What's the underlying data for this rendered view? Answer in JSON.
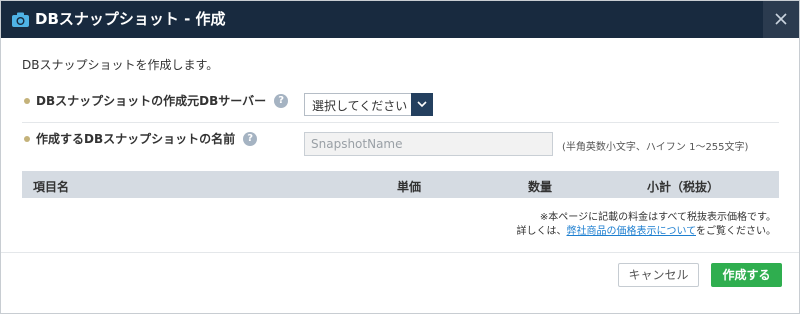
{
  "dialog": {
    "title": "DBスナップショット - 作成",
    "title_icon": "camera-icon",
    "close_icon": "close-icon",
    "intro": "DBスナップショットを作成します。"
  },
  "form": {
    "source_server": {
      "label": "DBスナップショットの作成元DBサーバー",
      "help": "?",
      "selected": "選択してください"
    },
    "snapshot_name": {
      "label": "作成するDBスナップショットの名前",
      "help": "?",
      "value": "",
      "placeholder": "SnapshotName",
      "hint": "(半角英数小文字、ハイフン 1～255文字)"
    }
  },
  "pricing_table": {
    "columns": [
      "項目名",
      "単価",
      "数量",
      "小計（税抜）"
    ]
  },
  "notes": {
    "line1": "※本ページに記載の料金はすべて税抜表示価格です。",
    "line2_prefix": "詳しくは、",
    "line2_link": "弊社商品の価格表示について",
    "line2_suffix": "をご覧ください。"
  },
  "buttons": {
    "cancel": "キャンセル",
    "create": "作成する"
  },
  "colors": {
    "titlebar": "#182a3f",
    "accent_green": "#2fae4f",
    "link": "#1e7fd0",
    "table_header": "#d5dbe2"
  }
}
